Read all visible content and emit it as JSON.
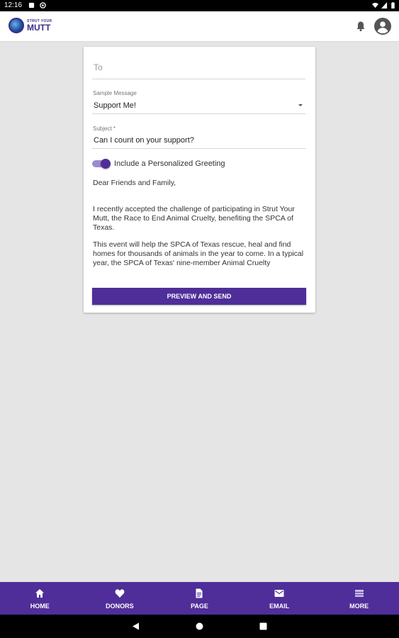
{
  "status_bar": {
    "time": "12:16"
  },
  "app_bar": {
    "logo_small": "STRUT YOUR",
    "logo_big": "MUTT"
  },
  "form": {
    "to_placeholder": "To",
    "sample_label": "Sample Message",
    "sample_value": "Support Me!",
    "subject_label": "Subject *",
    "subject_value": "Can I count on your support?",
    "greeting_toggle_label": "Include a Personalized Greeting",
    "greeting_enabled": true,
    "message_paragraphs": [
      "Dear Friends and Family,",
      "I recently accepted the challenge of participating in Strut Your Mutt, the Race to End Animal Cruelty, benefiting the SPCA of Texas.",
      "This event will help the SPCA of Texas rescue, heal and find homes for thousands of animals in the year to come. In a typical year, the SPCA of Texas' nine-member Animal Cruelty"
    ],
    "send_button": "PREVIEW AND SEND"
  },
  "bottom_nav": [
    {
      "label": "HOME",
      "icon": "home-icon"
    },
    {
      "label": "DONORS",
      "icon": "heart-icon"
    },
    {
      "label": "PAGE",
      "icon": "page-icon"
    },
    {
      "label": "EMAIL",
      "icon": "email-icon"
    },
    {
      "label": "MORE",
      "icon": "menu-icon"
    }
  ],
  "colors": {
    "primary": "#4f2e9a",
    "toggle_track": "#9d8ccd",
    "background": "#e5e5e5"
  }
}
